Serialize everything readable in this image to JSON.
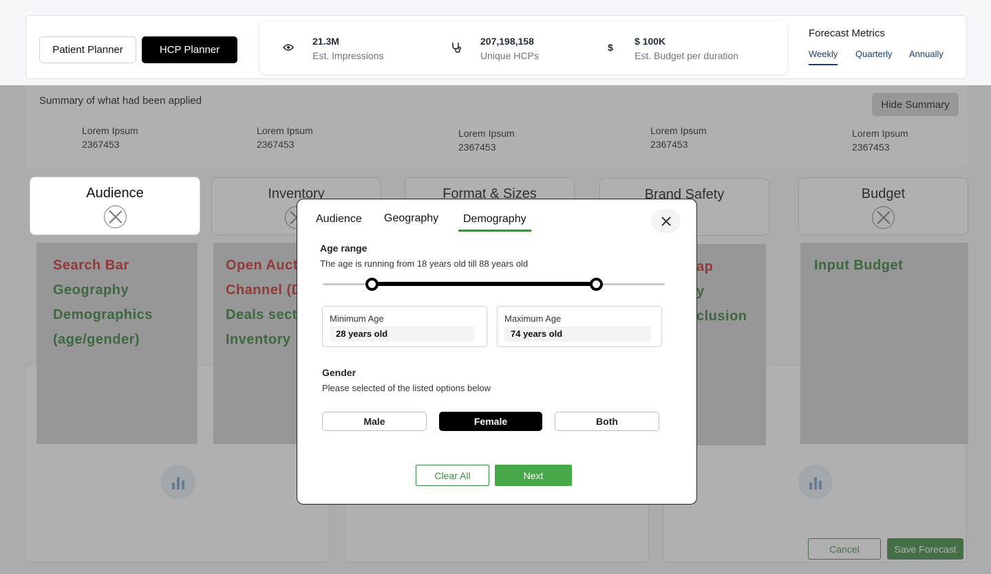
{
  "header": {
    "planner_tabs": [
      "Patient Planner",
      "HCP Planner"
    ],
    "metrics": [
      {
        "icon": "eye-icon",
        "value": "21.3M",
        "label": "Est. Impressions"
      },
      {
        "icon": "stethoscope-icon",
        "value": "207,198,158",
        "label": "Unique HCPs"
      },
      {
        "icon": "dollar-icon",
        "value": "$ 100K",
        "label": "Est. Budget per duration"
      }
    ],
    "forecast": {
      "title": "Forecast Metrics",
      "tabs": [
        "Weekly",
        "Quarterly",
        "Annually"
      ],
      "active_tab": "Weekly"
    }
  },
  "summary": {
    "title": "Summary of what had been applied",
    "hide_label": "Hide Summary",
    "items": [
      {
        "label": "Lorem Ipsum",
        "value": "2367453"
      },
      {
        "label": "Lorem Ipsum",
        "value": "2367453"
      },
      {
        "label": "Lorem Ipsum",
        "value": "2367453"
      },
      {
        "label": "Lorem Ipsum",
        "value": "2367453"
      },
      {
        "label": "Lorem Ipsum",
        "value": "2367453"
      }
    ]
  },
  "categories": [
    "Audience",
    "Inventory",
    "Format & Sizes",
    "Brand Safety",
    "Budget"
  ],
  "panels": {
    "audience": [
      "Search Bar",
      "Geography",
      "Demographics",
      "(age/gender)"
    ],
    "inventory": [
      "Open Aucti",
      "Channel (D",
      "Deals secti",
      "Inventory"
    ],
    "brand_safety": [
      "ap",
      "y",
      "clusion"
    ],
    "budget": [
      "Input Budget"
    ]
  },
  "footer": {
    "cancel_label": "Cancel",
    "save_label": "Save Forecast"
  },
  "modal": {
    "tabs": [
      "Audience",
      "Geography",
      "Demography"
    ],
    "active_tab": "Demography",
    "close_icon": "close-icon",
    "age_range": {
      "title": "Age range",
      "description": "The age is running from 18 years old till 88 years old",
      "slider_min": 18,
      "slider_max": 88,
      "selected_min": 28,
      "selected_max": 74,
      "min_label": "Minimum Age",
      "min_value": "28 years old",
      "max_label": "Maximum Age",
      "max_value": "74 years old"
    },
    "gender": {
      "title": "Gender",
      "description": "Please selected of the listed options below",
      "options": [
        "Male",
        "Female",
        "Both"
      ],
      "selected": "Female"
    },
    "clear_label": "Clear All",
    "next_label": "Next"
  },
  "colors": {
    "accent_green": "#47a84a",
    "dark_green": "#3d8b40",
    "red_text": "#c62828",
    "nav_blue": "#1f3c6e"
  }
}
